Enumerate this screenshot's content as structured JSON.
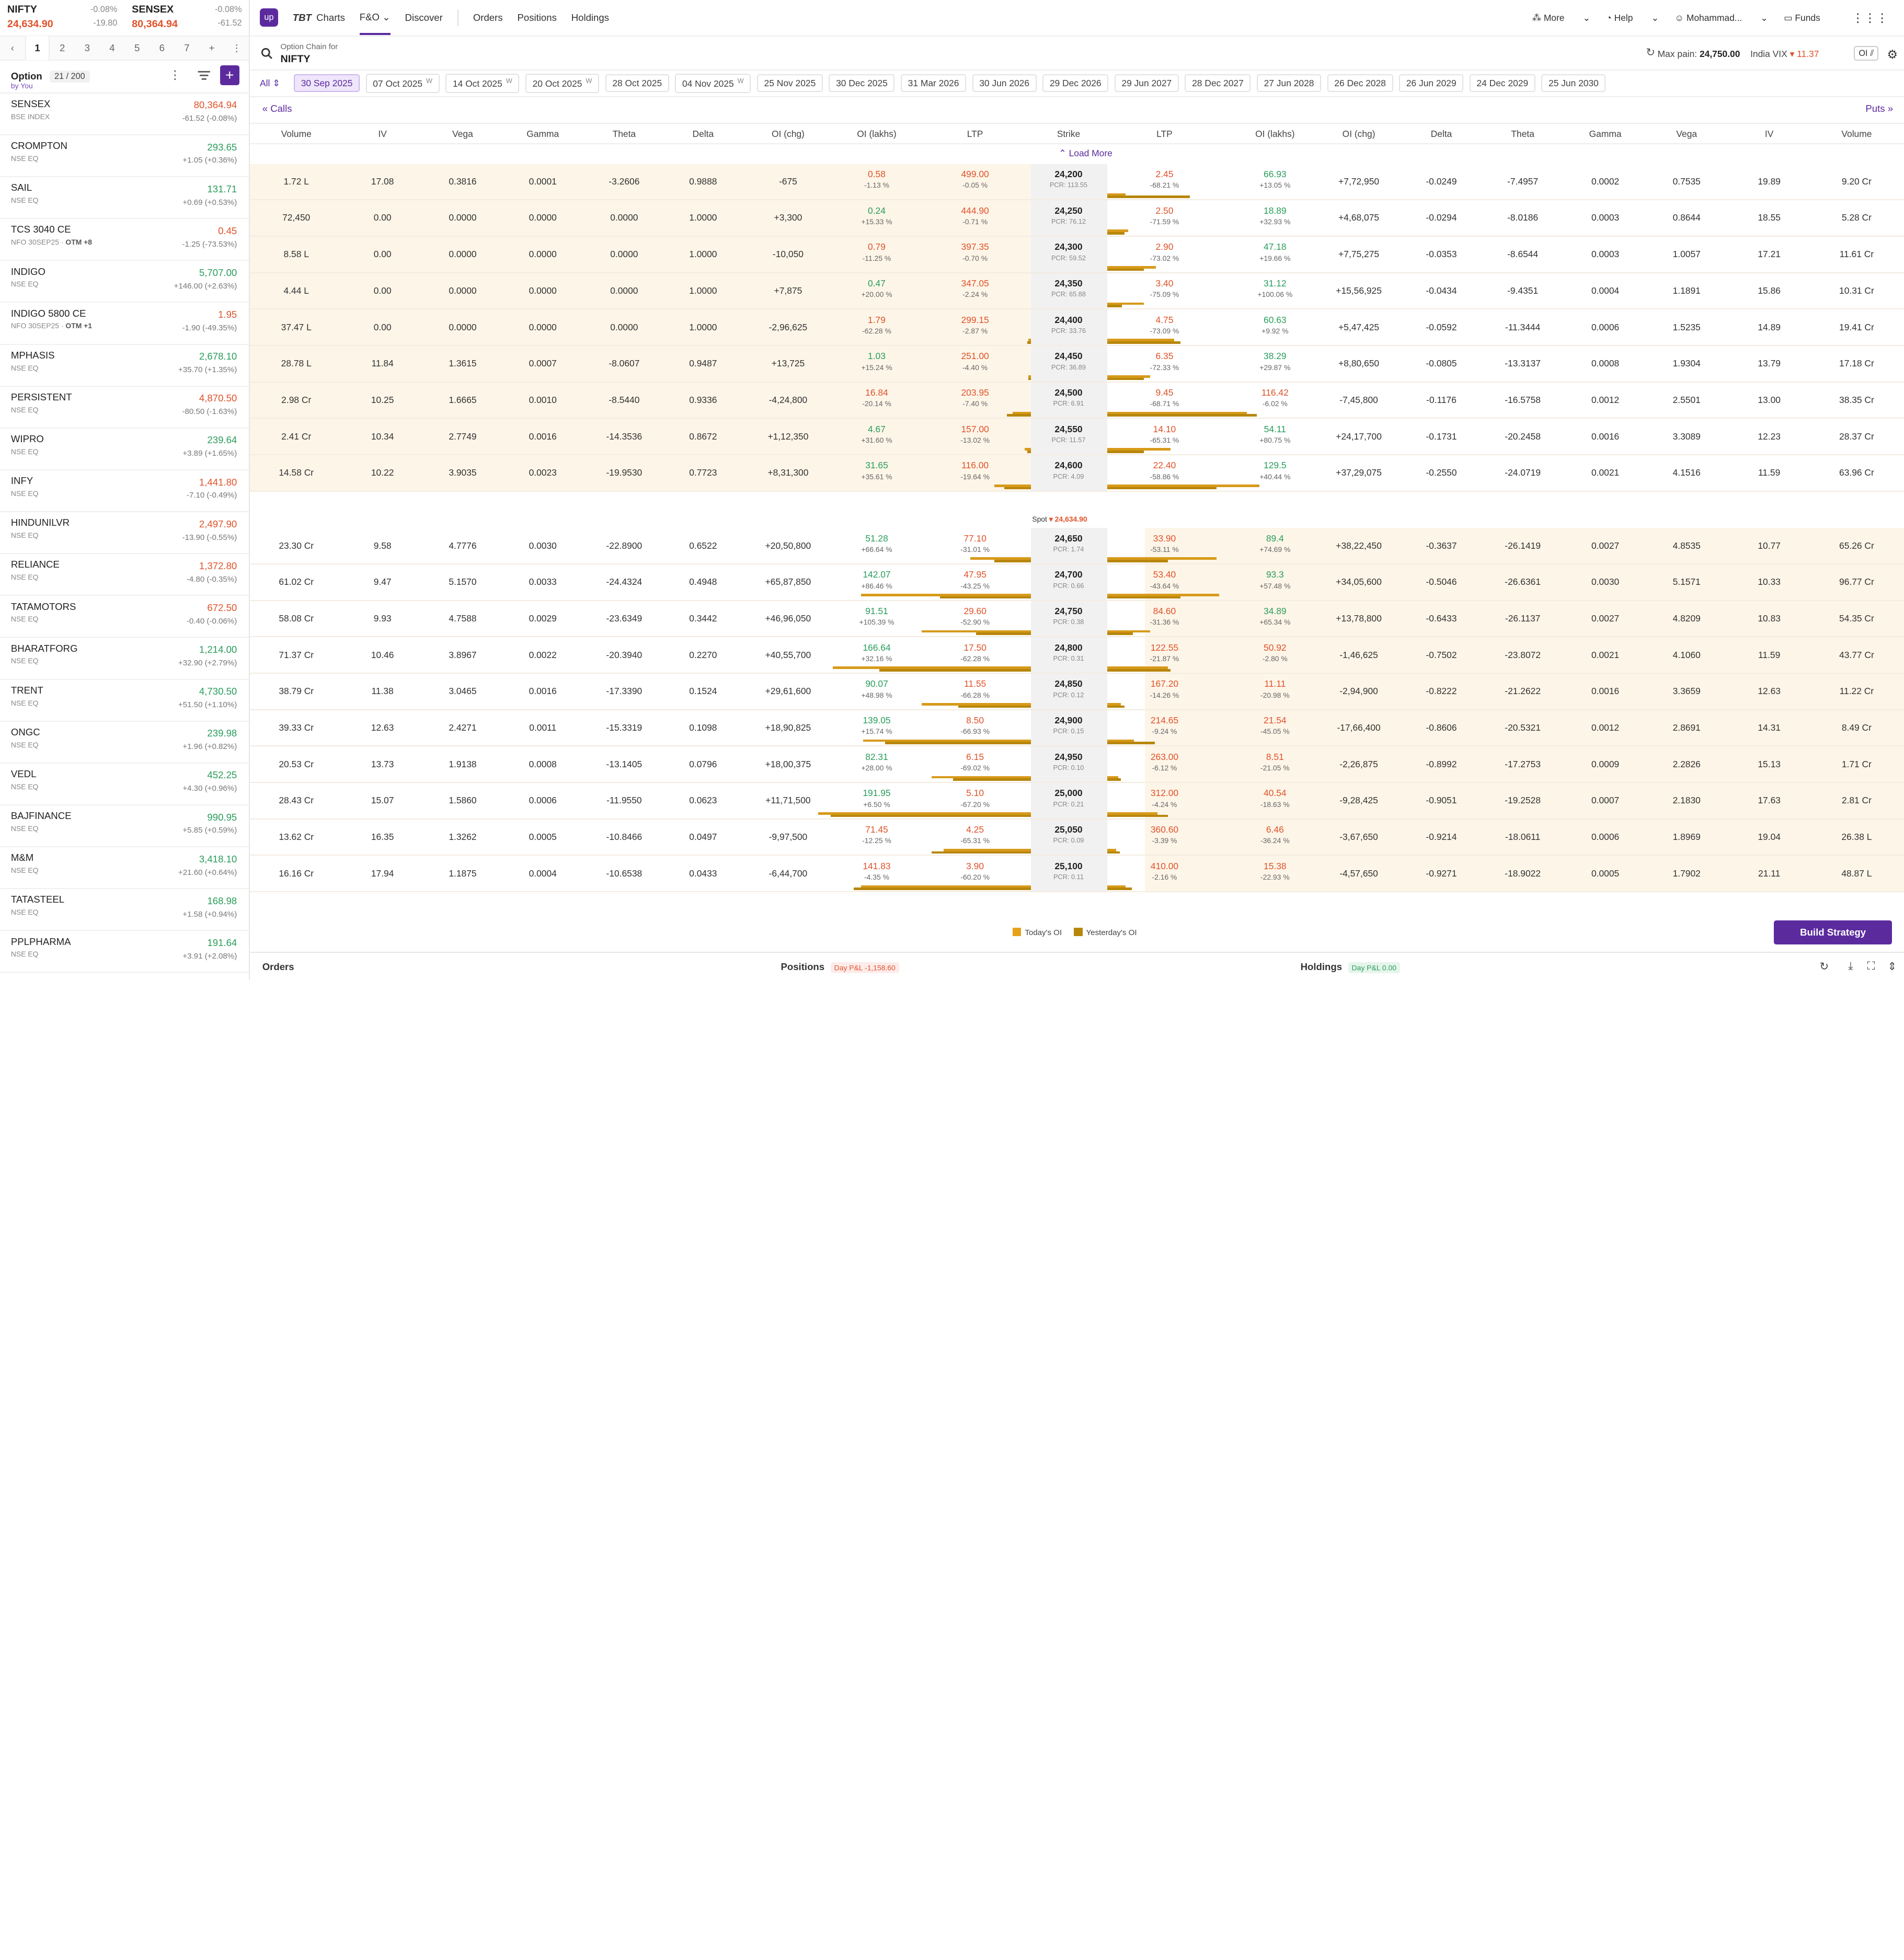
{
  "indices": [
    {
      "name": "NIFTY",
      "change": "-0.08%",
      "value": "24,634.90",
      "abs": "-19.80"
    },
    {
      "name": "SENSEX",
      "change": "-0.08%",
      "value": "80,364.94",
      "abs": "-61.52"
    }
  ],
  "tabs": [
    "1",
    "2",
    "3",
    "4",
    "5",
    "6",
    "7",
    "+"
  ],
  "watchlist": {
    "title": "Option",
    "count": "21 / 200",
    "by": "by You"
  },
  "items": [
    {
      "s": "SENSEX",
      "ex": "BSE INDEX",
      "p": "80,364.94",
      "ch": "-61.52 (-0.08%)",
      "d": "dn"
    },
    {
      "s": "CROMPTON",
      "ex": "NSE EQ",
      "p": "293.65",
      "ch": "+1.05 (+0.36%)",
      "d": "up"
    },
    {
      "s": "SAIL",
      "ex": "NSE EQ",
      "p": "131.71",
      "ch": "+0.69 (+0.53%)",
      "d": "up"
    },
    {
      "s": "TCS 3040 CE",
      "ex": "NFO 30SEP25 · ",
      "tag": "OTM +8",
      "p": "0.45",
      "ch": "-1.25 (-73.53%)",
      "d": "dn"
    },
    {
      "s": "INDIGO",
      "ex": "NSE EQ",
      "p": "5,707.00",
      "ch": "+146.00 (+2.63%)",
      "d": "up"
    },
    {
      "s": "INDIGO 5800 CE",
      "ex": "NFO 30SEP25 · ",
      "tag": "OTM +1",
      "p": "1.95",
      "ch": "-1.90 (-49.35%)",
      "d": "dn"
    },
    {
      "s": "MPHASIS",
      "ex": "NSE EQ",
      "p": "2,678.10",
      "ch": "+35.70 (+1.35%)",
      "d": "up"
    },
    {
      "s": "PERSISTENT",
      "ex": "NSE EQ",
      "p": "4,870.50",
      "ch": "-80.50 (-1.63%)",
      "d": "dn"
    },
    {
      "s": "WIPRO",
      "ex": "NSE EQ",
      "p": "239.64",
      "ch": "+3.89 (+1.65%)",
      "d": "up"
    },
    {
      "s": "INFY",
      "ex": "NSE EQ",
      "p": "1,441.80",
      "ch": "-7.10 (-0.49%)",
      "d": "dn"
    },
    {
      "s": "HINDUNILVR",
      "ex": "NSE EQ",
      "p": "2,497.90",
      "ch": "-13.90 (-0.55%)",
      "d": "dn"
    },
    {
      "s": "RELIANCE",
      "ex": "NSE EQ",
      "p": "1,372.80",
      "ch": "-4.80 (-0.35%)",
      "d": "dn"
    },
    {
      "s": "TATAMOTORS",
      "ex": "NSE EQ",
      "p": "672.50",
      "ch": "-0.40 (-0.06%)",
      "d": "dn"
    },
    {
      "s": "BHARATFORG",
      "ex": "NSE EQ",
      "p": "1,214.00",
      "ch": "+32.90 (+2.79%)",
      "d": "up"
    },
    {
      "s": "TRENT",
      "ex": "NSE EQ",
      "p": "4,730.50",
      "ch": "+51.50 (+1.10%)",
      "d": "up"
    },
    {
      "s": "ONGC",
      "ex": "NSE EQ",
      "p": "239.98",
      "ch": "+1.96 (+0.82%)",
      "d": "up"
    },
    {
      "s": "VEDL",
      "ex": "NSE EQ",
      "p": "452.25",
      "ch": "+4.30 (+0.96%)",
      "d": "up"
    },
    {
      "s": "BAJFINANCE",
      "ex": "NSE EQ",
      "p": "990.95",
      "ch": "+5.85 (+0.59%)",
      "d": "up"
    },
    {
      "s": "M&M",
      "ex": "NSE EQ",
      "p": "3,418.10",
      "ch": "+21.60 (+0.64%)",
      "d": "up"
    },
    {
      "s": "TATASTEEL",
      "ex": "NSE EQ",
      "p": "168.98",
      "ch": "+1.58 (+0.94%)",
      "d": "up"
    },
    {
      "s": "PPLPHARMA",
      "ex": "NSE EQ",
      "p": "191.64",
      "ch": "+3.91 (+2.08%)",
      "d": "up"
    }
  ],
  "nav": {
    "charts": "Charts",
    "fo": "F&O",
    "discover": "Discover",
    "orders": "Orders",
    "positions": "Positions",
    "holdings": "Holdings",
    "more": "More",
    "help": "Help",
    "user": "Mohammad...",
    "funds": "Funds"
  },
  "chain": {
    "label": "Option Chain for",
    "symbol": "NIFTY",
    "maxpain_label": "Max pain:",
    "maxpain": "24,750.00",
    "vix_label": "India VIX",
    "vix": "11.37",
    "oi": "OI"
  },
  "expiry_all": "All",
  "expiries": [
    {
      "d": "30 Sep 2025",
      "w": ""
    },
    {
      "d": "07 Oct 2025",
      "w": "W"
    },
    {
      "d": "14 Oct 2025",
      "w": "W"
    },
    {
      "d": "20 Oct 2025",
      "w": "W"
    },
    {
      "d": "28 Oct 2025",
      "w": ""
    },
    {
      "d": "04 Nov 2025",
      "w": "W"
    },
    {
      "d": "25 Nov 2025",
      "w": ""
    },
    {
      "d": "30 Dec 2025",
      "w": ""
    },
    {
      "d": "31 Mar 2026",
      "w": ""
    },
    {
      "d": "30 Jun 2026",
      "w": ""
    },
    {
      "d": "29 Dec 2026",
      "w": ""
    },
    {
      "d": "29 Jun 2027",
      "w": ""
    },
    {
      "d": "28 Dec 2027",
      "w": ""
    },
    {
      "d": "27 Jun 2028",
      "w": ""
    },
    {
      "d": "26 Dec 2028",
      "w": ""
    },
    {
      "d": "26 Jun 2029",
      "w": ""
    },
    {
      "d": "24 Dec 2029",
      "w": ""
    },
    {
      "d": "25 Jun 2030",
      "w": ""
    }
  ],
  "calls": "Calls",
  "puts": "Puts",
  "load_more": "Load More",
  "columns": [
    "Volume",
    "IV",
    "Vega",
    "Gamma",
    "Theta",
    "Delta",
    "OI (chg)",
    "OI (lakhs)",
    "LTP",
    "Strike",
    "LTP",
    "OI (lakhs)",
    "OI (chg)",
    "Delta",
    "Theta",
    "Gamma",
    "Vega",
    "IV",
    "Volume"
  ],
  "spot": {
    "label": "Spot",
    "value": "24,634.90"
  },
  "rows": [
    {
      "itm": "call",
      "cv": "1.72 L",
      "civ": "17.08",
      "cvg": "0.3816",
      "cg": "0.0001",
      "ct": "-3.2606",
      "cd": "0.9888",
      "coc": "-675",
      "col": "0.58",
      "colp": "-1.13 %",
      "cl": "499.00",
      "clp": "-0.05 %",
      "k": "24,200",
      "pcr": "PCR: 113.55",
      "pl": "2.45",
      "plp": "-68.21 %",
      "pol": "66.93",
      "polp": "+13.05 %",
      "poc": "+7,72,950",
      "pd": "-0.0249",
      "pt": "-7.4957",
      "pg": "0.0002",
      "pvg": "0.7535",
      "piv": "19.89",
      "pv": "9.20 Cr",
      "cb": [
        0,
        0
      ],
      "pb": [
        15,
        68
      ]
    },
    {
      "itm": "call",
      "cv": "72,450",
      "civ": "0.00",
      "cvg": "0.0000",
      "cg": "0.0000",
      "ct": "0.0000",
      "cd": "1.0000",
      "coc": "+3,300",
      "col": "0.24",
      "colp": "+15.33 %",
      "cl": "444.90",
      "clp": "-0.71 %",
      "k": "24,250",
      "pcr": "PCR: 76.12",
      "pl": "2.50",
      "plp": "-71.59 %",
      "pol": "18.89",
      "polp": "+32.93 %",
      "poc": "+4,68,075",
      "pd": "-0.0294",
      "pt": "-8.0186",
      "pg": "0.0003",
      "pvg": "0.8644",
      "piv": "18.55",
      "pv": "5.28 Cr",
      "cb": [
        0,
        0
      ],
      "pb": [
        17,
        14
      ]
    },
    {
      "itm": "call",
      "cv": "8.58 L",
      "civ": "0.00",
      "cvg": "0.0000",
      "cg": "0.0000",
      "ct": "0.0000",
      "cd": "1.0000",
      "coc": "-10,050",
      "col": "0.79",
      "colp": "-11.25 %",
      "cl": "397.35",
      "clp": "-0.70 %",
      "k": "24,300",
      "pcr": "PCR: 59.52",
      "pl": "2.90",
      "plp": "-73.02 %",
      "pol": "47.18",
      "polp": "+19.66 %",
      "poc": "+7,75,275",
      "pd": "-0.0353",
      "pt": "-8.6544",
      "pg": "0.0003",
      "pvg": "1.0057",
      "piv": "17.21",
      "pv": "11.61 Cr",
      "cb": [
        0,
        0
      ],
      "pb": [
        40,
        30
      ]
    },
    {
      "itm": "call",
      "cv": "4.44 L",
      "civ": "0.00",
      "cvg": "0.0000",
      "cg": "0.0000",
      "ct": "0.0000",
      "cd": "1.0000",
      "coc": "+7,875",
      "col": "0.47",
      "colp": "+20.00 %",
      "cl": "347.05",
      "clp": "-2.24 %",
      "k": "24,350",
      "pcr": "PCR: 65.88",
      "pl": "3.40",
      "plp": "-75.09 %",
      "pol": "31.12",
      "polp": "+100.06 %",
      "poc": "+15,56,925",
      "pd": "-0.0434",
      "pt": "-9.4351",
      "pg": "0.0004",
      "pvg": "1.1891",
      "piv": "15.86",
      "pv": "10.31 Cr",
      "cb": [
        0,
        0
      ],
      "pb": [
        30,
        12
      ]
    },
    {
      "itm": "call",
      "cv": "37.47 L",
      "civ": "0.00",
      "cvg": "0.0000",
      "cg": "0.0000",
      "ct": "0.0000",
      "cd": "1.0000",
      "coc": "-2,96,625",
      "col": "1.79",
      "colp": "-62.28 %",
      "cl": "299.15",
      "clp": "-2.87 %",
      "k": "24,400",
      "pcr": "PCR: 33.76",
      "pl": "4.75",
      "plp": "-73.09 %",
      "pol": "60.63",
      "polp": "+9.92 %",
      "poc": "+5,47,425",
      "pd": "-0.0592",
      "pt": "-11.3444",
      "pg": "0.0006",
      "pvg": "1.5235",
      "piv": "14.89",
      "pv": "19.41 Cr",
      "cb": [
        2,
        3
      ],
      "pb": [
        55,
        60
      ]
    },
    {
      "itm": "call",
      "cv": "28.78 L",
      "civ": "11.84",
      "cvg": "1.3615",
      "cg": "0.0007",
      "ct": "-8.0607",
      "cd": "0.9487",
      "coc": "+13,725",
      "col": "1.03",
      "colp": "+15.24 %",
      "cl": "251.00",
      "clp": "-4.40 %",
      "k": "24,450",
      "pcr": "PCR: 36.89",
      "pl": "6.35",
      "plp": "-72.33 %",
      "pol": "38.29",
      "polp": "+29.87 %",
      "poc": "+8,80,650",
      "pd": "-0.0805",
      "pt": "-13.3137",
      "pg": "0.0008",
      "pvg": "1.9304",
      "piv": "13.79",
      "pv": "17.18 Cr",
      "cb": [
        2,
        2
      ],
      "pb": [
        35,
        30
      ]
    },
    {
      "itm": "call",
      "cv": "2.98 Cr",
      "civ": "10.25",
      "cvg": "1.6665",
      "cg": "0.0010",
      "ct": "-8.5440",
      "cd": "0.9336",
      "coc": "-4,24,800",
      "col": "16.84",
      "colp": "-20.14 %",
      "cl": "203.95",
      "clp": "-7.40 %",
      "k": "24,500",
      "pcr": "PCR: 6.91",
      "pl": "9.45",
      "plp": "-68.71 %",
      "pol": "116.42",
      "polp": "-6.02 %",
      "poc": "-7,45,800",
      "pd": "-0.1176",
      "pt": "-16.5758",
      "pg": "0.0012",
      "pvg": "2.5501",
      "piv": "13.00",
      "pv": "38.35 Cr",
      "cb": [
        15,
        20
      ],
      "pb": [
        115,
        123
      ]
    },
    {
      "itm": "call",
      "cv": "2.41 Cr",
      "civ": "10.34",
      "cvg": "2.7749",
      "cg": "0.0016",
      "ct": "-14.3536",
      "cd": "0.8672",
      "coc": "+1,12,350",
      "col": "4.67",
      "colp": "+31.60 %",
      "cl": "157.00",
      "clp": "-13.02 %",
      "k": "24,550",
      "pcr": "PCR: 11.57",
      "pl": "14.10",
      "plp": "-65.31 %",
      "pol": "54.11",
      "polp": "+80.75 %",
      "poc": "+24,17,700",
      "pd": "-0.1731",
      "pt": "-20.2458",
      "pg": "0.0016",
      "pvg": "3.3089",
      "piv": "12.23",
      "pv": "28.37 Cr",
      "cb": [
        5,
        3
      ],
      "pb": [
        52,
        30
      ]
    },
    {
      "itm": "call",
      "cv": "14.58 Cr",
      "civ": "10.22",
      "cvg": "3.9035",
      "cg": "0.0023",
      "ct": "-19.9530",
      "cd": "0.7723",
      "coc": "+8,31,300",
      "col": "31.65",
      "colp": "+35.61 %",
      "cl": "116.00",
      "clp": "-19.64 %",
      "k": "24,600",
      "pcr": "PCR: 4.09",
      "pl": "22.40",
      "plp": "-58.86 %",
      "pol": "129.5",
      "polp": "+40.44 %",
      "poc": "+37,29,075",
      "pd": "-0.2550",
      "pt": "-24.0719",
      "pg": "0.0021",
      "pvg": "4.1516",
      "piv": "11.59",
      "pv": "63.96 Cr",
      "cb": [
        30,
        22
      ],
      "pb": [
        125,
        90
      ]
    },
    {
      "itm": "put",
      "cv": "23.30 Cr",
      "civ": "9.58",
      "cvg": "4.7776",
      "cg": "0.0030",
      "ct": "-22.8900",
      "cd": "0.6522",
      "coc": "+20,50,800",
      "col": "51.28",
      "colp": "+66.64 %",
      "cl": "77.10",
      "clp": "-31.01 %",
      "k": "24,650",
      "pcr": "PCR: 1.74",
      "pl": "33.90",
      "plp": "-53.11 %",
      "pol": "89.4",
      "polp": "+74.69 %",
      "poc": "+38,22,450",
      "pd": "-0.3637",
      "pt": "-26.1419",
      "pg": "0.0027",
      "pvg": "4.8535",
      "piv": "10.77",
      "pv": "65.26 Cr",
      "cb": [
        50,
        30
      ],
      "pb": [
        90,
        50
      ]
    },
    {
      "itm": "put",
      "cv": "61.02 Cr",
      "civ": "9.47",
      "cvg": "5.1570",
      "cg": "0.0033",
      "ct": "-24.4324",
      "cd": "0.4948",
      "coc": "+65,87,850",
      "col": "142.07",
      "colp": "+86.46 %",
      "cl": "47.95",
      "clp": "-43.25 %",
      "k": "24,700",
      "pcr": "PCR: 0.66",
      "pl": "53.40",
      "plp": "-43.64 %",
      "pol": "93.3",
      "polp": "+57.48 %",
      "poc": "+34,05,600",
      "pd": "-0.5046",
      "pt": "-26.6361",
      "pg": "0.0030",
      "pvg": "5.1571",
      "piv": "10.33",
      "pv": "96.77 Cr",
      "cb": [
        140,
        75
      ],
      "pb": [
        92,
        60
      ]
    },
    {
      "itm": "put",
      "cv": "58.08 Cr",
      "civ": "9.93",
      "cvg": "4.7588",
      "cg": "0.0029",
      "ct": "-23.6349",
      "cd": "0.3442",
      "coc": "+46,96,050",
      "col": "91.51",
      "colp": "+105.39 %",
      "cl": "29.60",
      "clp": "-52.90 %",
      "k": "24,750",
      "pcr": "PCR: 0.38",
      "pl": "84.60",
      "plp": "-31.36 %",
      "pol": "34.89",
      "polp": "+65.34 %",
      "poc": "+13,78,800",
      "pd": "-0.6433",
      "pt": "-26.1137",
      "pg": "0.0027",
      "pvg": "4.8209",
      "piv": "10.83",
      "pv": "54.35 Cr",
      "cb": [
        90,
        45
      ],
      "pb": [
        35,
        21
      ]
    },
    {
      "itm": "put",
      "cv": "71.37 Cr",
      "civ": "10.46",
      "cvg": "3.8967",
      "cg": "0.0022",
      "ct": "-20.3940",
      "cd": "0.2270",
      "coc": "+40,55,700",
      "col": "166.64",
      "colp": "+32.16 %",
      "cl": "17.50",
      "clp": "-62.28 %",
      "k": "24,800",
      "pcr": "PCR: 0.31",
      "pl": "122.55",
      "plp": "-21.87 %",
      "pol": "50.92",
      "polp": "-2.80 %",
      "poc": "-1,46,625",
      "pd": "-0.7502",
      "pt": "-23.8072",
      "pg": "0.0021",
      "pvg": "4.1060",
      "piv": "11.59",
      "pv": "43.77 Cr",
      "cb": [
        163,
        125
      ],
      "pb": [
        50,
        52
      ]
    },
    {
      "itm": "put",
      "cv": "38.79 Cr",
      "civ": "11.38",
      "cvg": "3.0465",
      "cg": "0.0016",
      "ct": "-17.3390",
      "cd": "0.1524",
      "coc": "+29,61,600",
      "col": "90.07",
      "colp": "+48.98 %",
      "cl": "11.55",
      "clp": "-66.28 %",
      "k": "24,850",
      "pcr": "PCR: 0.12",
      "pl": "167.20",
      "plp": "-14.26 %",
      "pol": "11.11",
      "polp": "-20.98 %",
      "poc": "-2,94,900",
      "pd": "-0.8222",
      "pt": "-21.2622",
      "pg": "0.0016",
      "pvg": "3.3659",
      "piv": "12.63",
      "pv": "11.22 Cr",
      "cb": [
        90,
        60
      ],
      "pb": [
        11,
        14
      ]
    },
    {
      "itm": "put",
      "cv": "39.33 Cr",
      "civ": "12.63",
      "cvg": "2.4271",
      "cg": "0.0011",
      "ct": "-15.3319",
      "cd": "0.1098",
      "coc": "+18,90,825",
      "col": "139.05",
      "colp": "+15.74 %",
      "cl": "8.50",
      "clp": "-66.93 %",
      "k": "24,900",
      "pcr": "PCR: 0.15",
      "pl": "214.65",
      "plp": "-9.24 %",
      "pol": "21.54",
      "polp": "-45.05 %",
      "poc": "-17,66,400",
      "pd": "-0.8606",
      "pt": "-20.5321",
      "pg": "0.0012",
      "pvg": "2.8691",
      "piv": "14.31",
      "pv": "8.49 Cr",
      "cb": [
        138,
        120
      ],
      "pb": [
        22,
        39
      ]
    },
    {
      "itm": "put",
      "cv": "20.53 Cr",
      "civ": "13.73",
      "cvg": "1.9138",
      "cg": "0.0008",
      "ct": "-13.1405",
      "cd": "0.0796",
      "coc": "+18,00,375",
      "col": "82.31",
      "colp": "+28.00 %",
      "cl": "6.15",
      "clp": "-69.02 %",
      "k": "24,950",
      "pcr": "PCR: 0.10",
      "pl": "263.00",
      "plp": "-6.12 %",
      "pol": "8.51",
      "polp": "-21.05 %",
      "poc": "-2,26,875",
      "pd": "-0.8992",
      "pt": "-17.2753",
      "pg": "0.0009",
      "pvg": "2.2826",
      "piv": "15.13",
      "pv": "1.71 Cr",
      "cb": [
        82,
        64
      ],
      "pb": [
        9,
        11
      ]
    },
    {
      "itm": "put",
      "cv": "28.43 Cr",
      "civ": "15.07",
      "cvg": "1.5860",
      "cg": "0.0006",
      "ct": "-11.9550",
      "cd": "0.0623",
      "coc": "+11,71,500",
      "col": "191.95",
      "colp": "+6.50 %",
      "cl": "5.10",
      "clp": "-67.20 %",
      "k": "25,000",
      "pcr": "PCR: 0.21",
      "pl": "312.00",
      "plp": "-4.24 %",
      "pol": "40.54",
      "polp": "-18.63 %",
      "poc": "-9,28,425",
      "pd": "-0.9051",
      "pt": "-19.2528",
      "pg": "0.0007",
      "pvg": "2.1830",
      "piv": "17.63",
      "pv": "2.81 Cr",
      "cb": [
        175,
        165
      ],
      "pb": [
        41,
        50
      ]
    },
    {
      "itm": "put",
      "cv": "13.62 Cr",
      "civ": "16.35",
      "cvg": "1.3262",
      "cg": "0.0005",
      "ct": "-10.8466",
      "cd": "0.0497",
      "coc": "-9,97,500",
      "col": "71.45",
      "colp": "-12.25 %",
      "cl": "4.25",
      "clp": "-65.31 %",
      "k": "25,050",
      "pcr": "PCR: 0.09",
      "pl": "360.60",
      "plp": "-3.39 %",
      "pol": "6.46",
      "polp": "-36.24 %",
      "poc": "-3,67,650",
      "pd": "-0.9214",
      "pt": "-18.0611",
      "pg": "0.0006",
      "pvg": "1.8969",
      "piv": "19.04",
      "pv": "26.38 L",
      "cb": [
        72,
        82
      ],
      "pb": [
        7,
        10
      ]
    },
    {
      "itm": "put",
      "cv": "16.16 Cr",
      "civ": "17.94",
      "cvg": "1.1875",
      "cg": "0.0004",
      "ct": "-10.6538",
      "cd": "0.0433",
      "coc": "-6,44,700",
      "col": "141.83",
      "colp": "-4.35 %",
      "cl": "3.90",
      "clp": "-60.20 %",
      "k": "25,100",
      "pcr": "PCR: 0.11",
      "pl": "410.00",
      "plp": "-2.16 %",
      "pol": "15.38",
      "polp": "-22.93 %",
      "poc": "-4,57,650",
      "pd": "-0.9271",
      "pt": "-18.9022",
      "pg": "0.0005",
      "pvg": "1.7902",
      "piv": "21.11",
      "pv": "48.87 L",
      "cb": [
        140,
        146
      ],
      "pb": [
        15,
        20
      ]
    }
  ],
  "legend": {
    "today": "Today's OI",
    "yesterday": "Yesterday's OI",
    "today_color": "#e6a31a",
    "yesterday_color": "#b8860b"
  },
  "build": "Build Strategy",
  "footer": {
    "orders": "Orders",
    "positions": "Positions",
    "pos_pl": "Day P&L -1,158.60",
    "holdings": "Holdings",
    "hold_pl": "Day P&L 0.00"
  }
}
